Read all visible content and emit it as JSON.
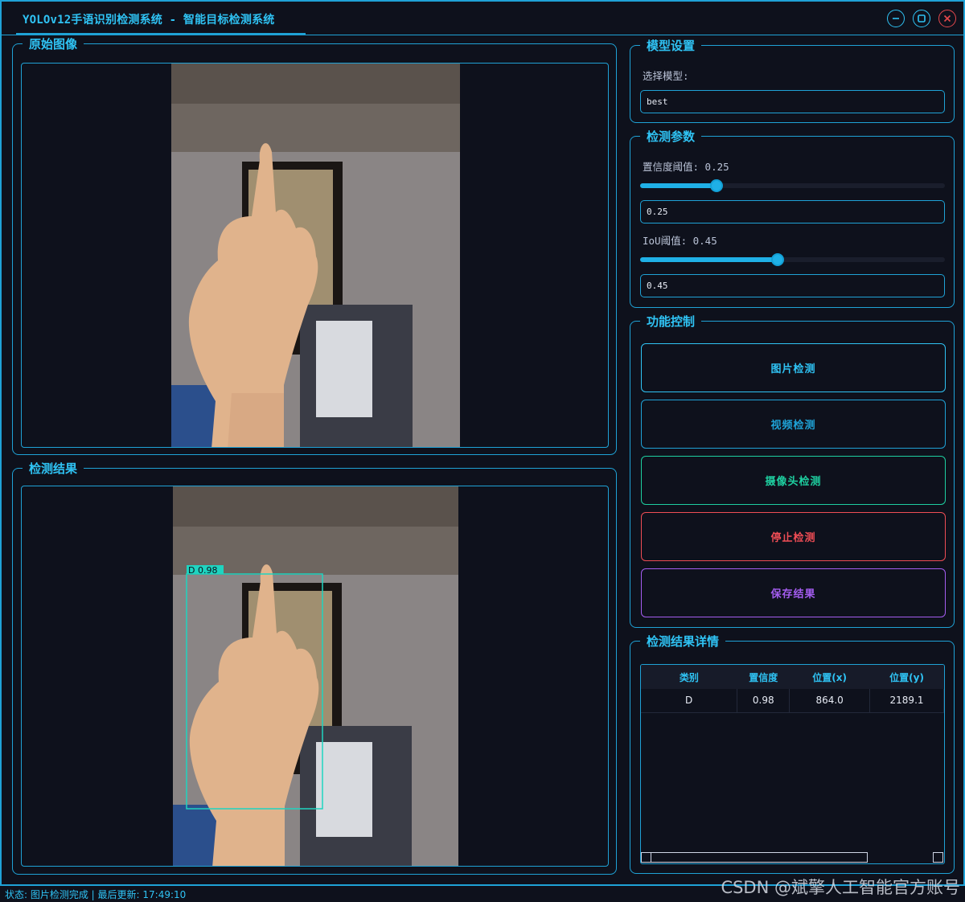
{
  "window": {
    "title": "YOLOv12手语识别检测系统 - 智能目标检测系统"
  },
  "panels": {
    "original_title": "原始图像",
    "result_title": "检测结果"
  },
  "detection_box": {
    "label": "D 0.98",
    "color": "#1fd4c0"
  },
  "model_settings": {
    "title": "模型设置",
    "select_label": "选择模型:",
    "selected_model": "best"
  },
  "detect_params": {
    "title": "检测参数",
    "conf_label": "置信度阈值: 0.25",
    "conf_value": "0.25",
    "conf_fraction": 0.25,
    "iou_label": "IoU阈值: 0.45",
    "iou_value": "0.45",
    "iou_fraction": 0.45
  },
  "controls": {
    "title": "功能控制",
    "buttons": [
      {
        "label": "图片检测",
        "color": "#2fc3f4"
      },
      {
        "label": "视频检测",
        "color": "#1fa2d6"
      },
      {
        "label": "摄像头检测",
        "color": "#1ecfa0"
      },
      {
        "label": "停止检测",
        "color": "#ef4d55"
      },
      {
        "label": "保存结果",
        "color": "#a45df0"
      }
    ]
  },
  "results": {
    "title": "检测结果详情",
    "headers": [
      "类别",
      "置信度",
      "位置(x)",
      "位置(y)"
    ],
    "rows": [
      [
        "D",
        "0.98",
        "864.0",
        "2189.1"
      ]
    ]
  },
  "status": "状态: 图片检测完成 | 最后更新: 17:49:10",
  "watermark": "CSDN @斌擎人工智能官方账号"
}
